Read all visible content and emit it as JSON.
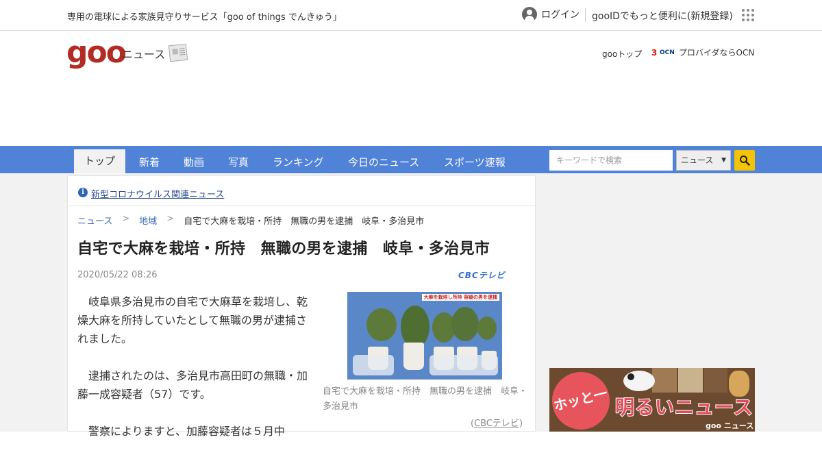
{
  "topbar": {
    "promo": "専用の電球による家族見守りサービス「goo of things でんきゅう」",
    "login": "ログイン",
    "register": "gooIDでもっと便利に(新規登録)"
  },
  "brand": {
    "logo": "goo",
    "section": "ニュース",
    "goo_top": "gooトップ",
    "ocn_mark": "3",
    "ocn_logo": "OCN",
    "ocn_link": "プロバイダならOCN"
  },
  "nav": {
    "tabs": [
      "トップ",
      "新着",
      "動画",
      "写真",
      "ランキング",
      "今日のニュース",
      "スポーツ速報"
    ],
    "search_placeholder": "キーワードで検索",
    "search_scope": "ニュース"
  },
  "covid_link": "新型コロナウイルス関連ニュース",
  "breadcrumb": {
    "items": [
      "ニュース",
      "地域"
    ],
    "separator": ">",
    "current": "自宅で大麻を栽培・所持　無職の男を逮捕　岐阜・多治見市"
  },
  "article": {
    "title": "自宅で大麻を栽培・所持　無職の男を逮捕　岐阜・多治見市",
    "date": "2020/05/22 08:26",
    "source_logo": "CBCテレビ",
    "paragraphs": [
      "岐阜県多治見市の自宅で大麻草を栽培し、乾燥大麻を所持していたとして無職の男が逮捕されました。",
      "逮捕されたのは、多治見市高田町の無職・加藤一成容疑者（57）です。",
      "警察によりますと、加藤容疑者は５月中"
    ],
    "photo_overlay": "大麻を栽培し所持 容疑の男を逮捕",
    "photo_caption": "自宅で大麻を栽培・所持　無職の男を逮捕　岐阜・多治見市",
    "photo_credit": "CBCテレビ"
  },
  "side_ad": {
    "bubble": "ホッと一息",
    "title": "明るいニュース",
    "logo": "goo ニュース"
  },
  "colors": {
    "nav": "#5082d7",
    "logo": "#b22c23",
    "search_button": "#f4c400",
    "link": "#3a6bb8"
  }
}
